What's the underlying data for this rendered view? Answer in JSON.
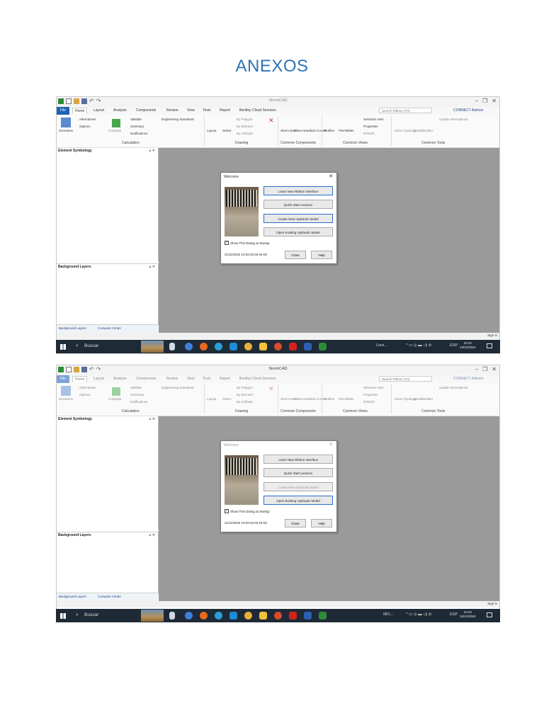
{
  "document": {
    "heading": "ANEXOS"
  },
  "screenshots": [
    {
      "app_title": "StormCAD",
      "tabs": [
        "File",
        "Home",
        "Layout",
        "Analysis",
        "Components",
        "Review",
        "View",
        "Tools",
        "Report",
        "Bentley Cloud Services"
      ],
      "search_placeholder": "Search Ribbon (F3)",
      "connect_label": "CONNECT Advisor",
      "ribbon": {
        "scenarios": "Scenarios",
        "alternatives": "Alternatives",
        "options": "Options",
        "compute": "Compute",
        "validate": "Validate",
        "summary": "Summary",
        "notifications": "Notifications",
        "engineering_standards": "Engineering Standards",
        "calculation_group": "Calculation",
        "layout": "Layout",
        "select": "Select",
        "by_polygon": "By Polygon",
        "by_element": "By Element",
        "by_attribute": "By Attribute",
        "drawing_group": "Drawing",
        "storm_data": "Storm Data",
        "flow_headloss": "Flow-Headloss Curves",
        "common_components_group": "Common Components",
        "profiles": "Profiles",
        "flextables": "FlexTables",
        "selection_sets": "Selection Sets",
        "properties": "Properties",
        "refresh": "Refresh",
        "common_views_group": "Common Views",
        "active_topology": "Active Topology",
        "modelbuilder": "ModelBuilder",
        "update_descriptions": "Update Descriptions",
        "common_tools_group": "Common Tools"
      },
      "panels": {
        "element_symbology": "Element Symbology",
        "background_layers": "Background Layers",
        "bottom_tab_1": "Background Layers",
        "bottom_tab_2": "Compute Center"
      },
      "status_signin": "Sign in",
      "dialog": {
        "title": "Welcome",
        "buttons": [
          "Learn New Ribbon Interface",
          "Quick Start Lessons",
          "Create New Hydraulic Model",
          "Open Existing Hydraulic Model"
        ],
        "show_at_startup": "Show This Dialog at Startup",
        "date": "21/11/2019 10:02:03.03 64-bit",
        "close": "Close",
        "help": "Help"
      },
      "taskbar": {
        "search": "Buscar",
        "tray_app": "Llovi...",
        "lang": "ESP",
        "time": "10:22",
        "date": "13/12/2024"
      }
    },
    {
      "app_title": "StormCAD",
      "tabs": [
        "File",
        "Home",
        "Layout",
        "Analysis",
        "Components",
        "Review",
        "View",
        "Tools",
        "Report",
        "Bentley Cloud Services"
      ],
      "search_placeholder": "Search Ribbon (F3)",
      "connect_label": "CONNECT Advisor",
      "ribbon": {
        "scenarios": "Scenarios",
        "alternatives": "Alternatives",
        "options": "Options",
        "compute": "Compute",
        "validate": "Validate",
        "summary": "Summary",
        "notifications": "Notifications",
        "engineering_standards": "Engineering Standards",
        "calculation_group": "Calculation",
        "layout": "Layout",
        "select": "Select",
        "by_polygon": "By Polygon",
        "by_element": "By Element",
        "by_attribute": "By Attribute",
        "drawing_group": "Drawing",
        "storm_data": "Storm Data",
        "flow_headloss": "Flow-Headloss Curves",
        "common_components_group": "Common Components",
        "profiles": "Profiles",
        "flextables": "FlexTables",
        "selection_sets": "Selection Sets",
        "properties": "Properties",
        "refresh": "Refresh",
        "common_views_group": "Common Views",
        "active_topology": "Active Topology",
        "modelbuilder": "ModelBuilder",
        "update_descriptions": "Update Descriptions",
        "common_tools_group": "Common Tools"
      },
      "panels": {
        "element_symbology": "Element Symbology",
        "background_layers": "Background Layers",
        "bottom_tab_1": "Background Layers",
        "bottom_tab_2": "Compute Center"
      },
      "status_signin": "Sign in",
      "dialog": {
        "title": "Welcome",
        "buttons": [
          "Learn New Ribbon Interface",
          "Quick Start Lessons",
          "Create New Hydraulic Model",
          "Open Existing Hydraulic Model"
        ],
        "show_at_startup": "Show This Dialog at Startup",
        "date": "21/11/2019 10:02:03.03 64-bit",
        "close": "Close",
        "help": "Help"
      },
      "taskbar": {
        "search": "Buscar",
        "tray_app": "IBO...",
        "lang": "ESP",
        "time": "10:34",
        "date": "13/12/2024"
      }
    }
  ],
  "colors": {
    "heading": "#2e74b5",
    "file_tab": "#1f62b5",
    "canvas": "#9a9a9a",
    "taskbar": "#1e2a36",
    "focus": "#2a6cd0"
  }
}
